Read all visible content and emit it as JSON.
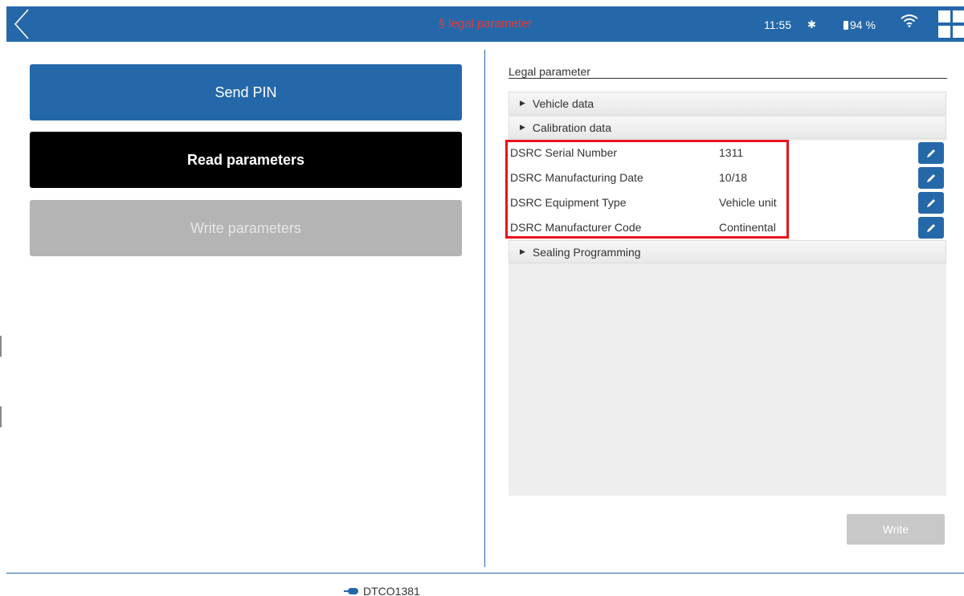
{
  "header": {
    "title": "§ legal parameter",
    "time": "11:55",
    "bluetooth_icon": "bluetooth-icon",
    "battery": "94 %",
    "wifi_icon": "wifi-icon",
    "menu_icon": "grid-menu-icon",
    "back_icon": "chevron-left-icon",
    "colors": {
      "bar": "#2568aa",
      "title": "#e03b3b"
    }
  },
  "left": {
    "send_pin": "Send PIN",
    "read_parameters": "Read parameters",
    "write_parameters": "Write parameters"
  },
  "right": {
    "title": "Legal parameter",
    "sections": {
      "vehicle_data": "Vehicle data",
      "calibration_data": "Calibration data",
      "sealing_programming": "Sealing Programming"
    },
    "rows": [
      {
        "label": "DSRC Serial Number",
        "value": "1311"
      },
      {
        "label": "DSRC Manufacturing Date",
        "value": "10/18"
      },
      {
        "label": "DSRC Equipment Type",
        "value": "Vehicle unit"
      },
      {
        "label": "DSRC Manufacturer Code",
        "value": "Continental"
      }
    ],
    "highlight_color": "#e8131b",
    "write_button": "Write"
  },
  "footer": {
    "device": "DTCO1381",
    "device_icon": "plug-icon"
  }
}
